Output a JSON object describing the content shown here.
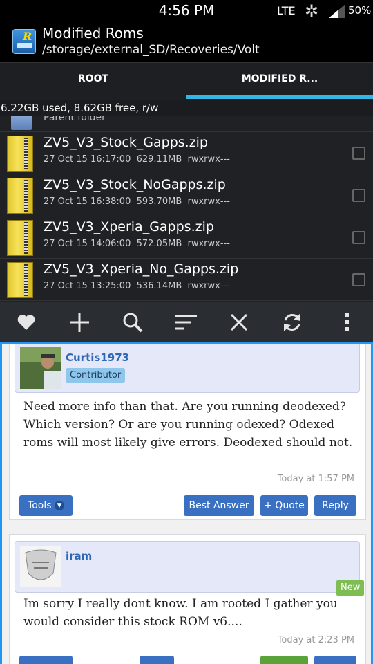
{
  "statusbar": {
    "time": "4:56 PM",
    "network": "LTE",
    "battery": "50%"
  },
  "app": {
    "title": "Modified Roms",
    "path": "/storage/external_SD/Recoveries/Volt"
  },
  "tabs": [
    {
      "label": "ROOT"
    },
    {
      "label": "MODIFIED R..."
    }
  ],
  "storage_info": "6.22GB used, 8.62GB free, r/w",
  "parent_folder": "Parent folder",
  "files": [
    {
      "name": "ZV5_V3_Stock_Gapps.zip",
      "date": "27 Oct 15 16:17:00",
      "size": "629.11MB",
      "perms": "rwxrwx---"
    },
    {
      "name": "ZV5_V3_Stock_NoGapps.zip",
      "date": "27 Oct 15 16:38:00",
      "size": "593.70MB",
      "perms": "rwxrwx---"
    },
    {
      "name": "ZV5_V3_Xperia_Gapps.zip",
      "date": "27 Oct 15 14:06:00",
      "size": "572.05MB",
      "perms": "rwxrwx---"
    },
    {
      "name": "ZV5_V3_Xperia_No_Gapps.zip",
      "date": "27 Oct 15 13:25:00",
      "size": "536.14MB",
      "perms": "rwxrwx---"
    }
  ],
  "toolbar": [
    "heart-icon",
    "plus-icon",
    "search-icon",
    "sort-icon",
    "close-icon",
    "refresh-icon",
    "more-icon"
  ],
  "posts": [
    {
      "user": "Curtis1973",
      "role": "Contributor",
      "text": "Need more info than that. Are you running deodexed? Which version? Or are you running odexed? Odexed roms will most likely give errors. Deodexed should not.",
      "time": "Today at 1:57 PM",
      "buttons": {
        "tools": "Tools",
        "best": "Best Answer",
        "quote": "+ Quote",
        "reply": "Reply"
      }
    },
    {
      "user": "iram",
      "badge": "New",
      "text": "Im sorry I really dont know. I am rooted I gather you would consider this stock ROM v6....",
      "time": "Today at 2:23 PM"
    }
  ],
  "colors": {
    "accent": "#33b5e5",
    "link": "#2e67b4",
    "button": "#3a70c2",
    "new": "#7dbd51",
    "webview_border": "#2196f3"
  }
}
